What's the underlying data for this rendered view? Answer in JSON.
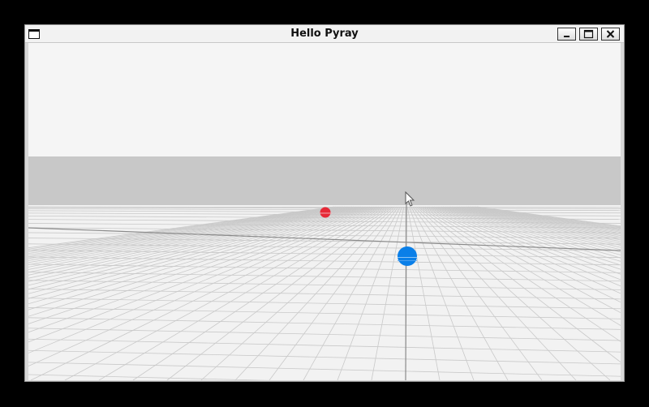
{
  "window": {
    "title": "Hello Pyray",
    "controls": {
      "minimize_icon": "minimize-icon",
      "maximize_icon": "maximize-icon",
      "close_icon": "close-icon",
      "menu_icon": "window-menu-icon"
    }
  },
  "scene": {
    "background_color": "#f5f5f5",
    "horizon_band_color": "#c8c8c8",
    "ground_color": "#f2f2f2",
    "grid_color": "#c9c9c9",
    "axis_color": "#8a8a8a",
    "spheres": [
      {
        "name": "red-sphere",
        "color": "#e62937"
      },
      {
        "name": "blue-sphere",
        "color": "#0a7fe8"
      }
    ],
    "cursor_icon": "mouse-pointer-icon"
  }
}
